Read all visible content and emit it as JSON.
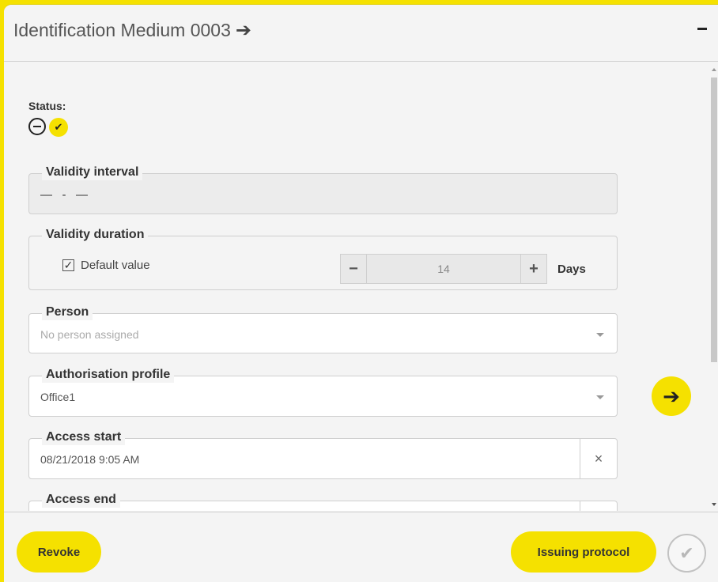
{
  "header": {
    "title": "Identification Medium 0003",
    "arrow_glyph": "➔",
    "minimize_label": "–"
  },
  "status": {
    "label": "Status:",
    "icons": [
      "minus-circle-icon",
      "check-icon"
    ],
    "check_glyph": "✔"
  },
  "validity_interval": {
    "legend": "Validity interval",
    "value": "—   -   —"
  },
  "validity_duration": {
    "legend": "Validity duration",
    "default_label": "Default value",
    "default_checked": true,
    "check_glyph": "✓",
    "minus": "−",
    "value": "14",
    "plus": "+",
    "unit": "Days"
  },
  "person": {
    "legend": "Person",
    "placeholder": "No person assigned"
  },
  "authorisation_profile": {
    "legend": "Authorisation profile",
    "value": "Office1"
  },
  "access_start": {
    "legend": "Access start",
    "value": "08/21/2018 9:05 AM",
    "clear_glyph": "×"
  },
  "access_end": {
    "legend": "Access end",
    "value": ""
  },
  "go_button": {
    "glyph": "➔"
  },
  "footer": {
    "revoke_label": "Revoke",
    "issuing_label": "Issuing protocol",
    "confirm_glyph": "✔"
  },
  "colors": {
    "accent": "#f5e100",
    "background": "#f4f4f4",
    "border": "#cfcfcf"
  }
}
